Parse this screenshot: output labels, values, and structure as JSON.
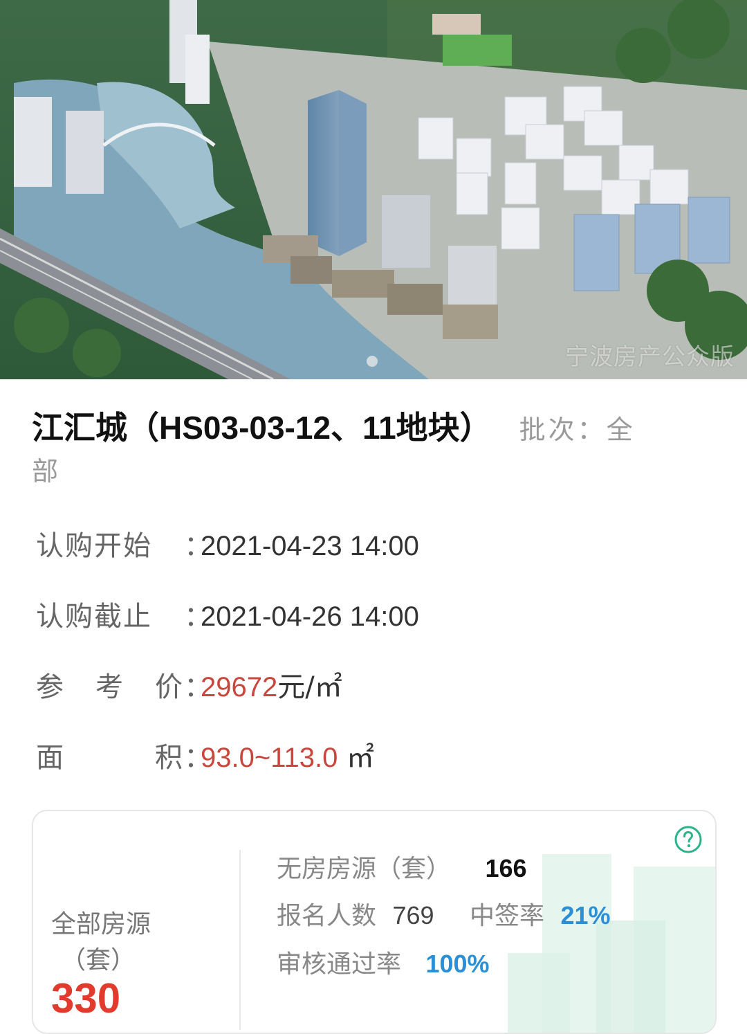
{
  "hero": {
    "watermark": "宁波房产公众版"
  },
  "project": {
    "title": "江汇城（HS03-03-12、11地块）",
    "batch_label": "批次：全",
    "batch_label_wrap": "部"
  },
  "info": {
    "start": {
      "label": "认购开始",
      "value": "2021-04-23 14:00"
    },
    "end": {
      "label": "认购截止",
      "value": "2021-04-26 14:00"
    },
    "price": {
      "label_chars": [
        "参",
        "考",
        "价"
      ],
      "value": "29672",
      "unit": "元/㎡"
    },
    "area": {
      "label_chars": [
        "面",
        "积"
      ],
      "value": "93.0~113.0",
      "unit": " ㎡"
    },
    "colon": "："
  },
  "stats": {
    "all_label": "全部房源",
    "all_unit": "（套）",
    "all_count": "330",
    "no_house_label": "无房房源（套）",
    "no_house_value": "166",
    "signup_label": "报名人数",
    "signup_value": "769",
    "win_rate_label": "中签率",
    "win_rate_value": "21%",
    "pass_rate_label": "审核通过率",
    "pass_rate_value": "100%"
  },
  "colors": {
    "price_red": "#c9463d",
    "count_red": "#e23b2e",
    "rate_blue": "#2b8fd6",
    "help_green": "#2bb38b"
  }
}
